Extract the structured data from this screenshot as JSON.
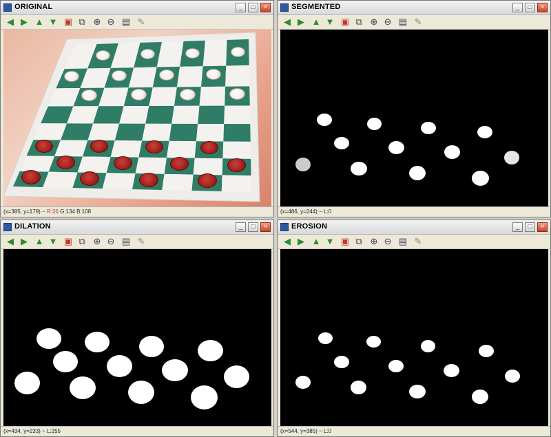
{
  "windows": [
    {
      "id": "original",
      "title": "ORIGINAL",
      "status": {
        "coords": "(x=385, y=179) ~",
        "r": "R:26",
        "rest": "G:134 B:108"
      }
    },
    {
      "id": "segmented",
      "title": "SEGMENTED",
      "status": {
        "coords": "(x=486, y=244) ~",
        "r": "",
        "rest": "L:0"
      }
    },
    {
      "id": "dilation",
      "title": "DILATION",
      "status": {
        "coords": "(x=434, y=233) ~",
        "r": "",
        "rest": "L:255"
      }
    },
    {
      "id": "erosion",
      "title": "EROSION",
      "status": {
        "coords": "(x=544, y=385) ~",
        "r": "",
        "rest": "L:0"
      }
    }
  ],
  "toolbar_icons": [
    "arrow-left-icon",
    "arrow-right-icon",
    "arrow-up-icon",
    "arrow-down-icon",
    "save-image-icon",
    "copy-icon",
    "zoom-in-icon",
    "zoom-out-icon",
    "save-icon",
    "properties-icon"
  ],
  "window_controls": {
    "minimize": "_",
    "maximize": "□",
    "close": "×"
  },
  "colors": {
    "board_green": "#2f7d66",
    "board_light": "#f4f2ee",
    "piece_red": "#a8221f",
    "piece_white": "#f5efe8",
    "mask_white": "#ffffff",
    "mask_black": "#000000"
  }
}
